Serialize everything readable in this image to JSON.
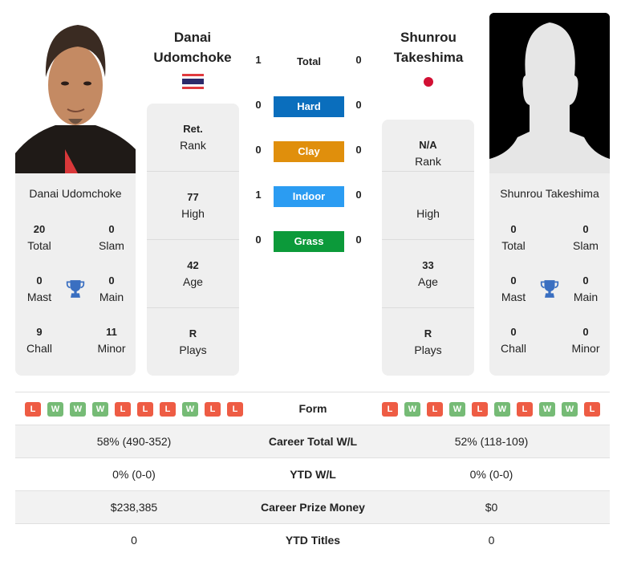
{
  "players": [
    {
      "name": "Danai Udomchoke",
      "title_line1": "Danai",
      "title_line2": "Udomchoke",
      "flag": "thailand-flag",
      "photo": "player-photo",
      "titles": {
        "total": {
          "value": "20",
          "label": "Total"
        },
        "slam": {
          "value": "0",
          "label": "Slam"
        },
        "mast": {
          "value": "0",
          "label": "Mast"
        },
        "main": {
          "value": "0",
          "label": "Main"
        },
        "chall": {
          "value": "9",
          "label": "Chall"
        },
        "minor": {
          "value": "11",
          "label": "Minor"
        }
      },
      "info": [
        {
          "value": "Ret.",
          "label": "Rank"
        },
        {
          "value": "77",
          "label": "High"
        },
        {
          "value": "42",
          "label": "Age"
        },
        {
          "value": "R",
          "label": "Plays"
        }
      ],
      "form": [
        "L",
        "W",
        "W",
        "W",
        "L",
        "L",
        "L",
        "W",
        "L",
        "L"
      ],
      "career_wl": "58% (490-352)",
      "ytd_wl": "0% (0-0)",
      "prize_money": "$238,385",
      "ytd_titles": "0"
    },
    {
      "name": "Shunrou Takeshima",
      "title_line1": "Shunrou",
      "title_line2": "Takeshima",
      "flag": "japan-flag",
      "photo": "silhouette-placeholder",
      "titles": {
        "total": {
          "value": "0",
          "label": "Total"
        },
        "slam": {
          "value": "0",
          "label": "Slam"
        },
        "mast": {
          "value": "0",
          "label": "Mast"
        },
        "main": {
          "value": "0",
          "label": "Main"
        },
        "chall": {
          "value": "0",
          "label": "Chall"
        },
        "minor": {
          "value": "0",
          "label": "Minor"
        }
      },
      "info": [
        {
          "value": "N/A",
          "label": "Rank"
        },
        {
          "value": "",
          "label": "High"
        },
        {
          "value": "33",
          "label": "Age"
        },
        {
          "value": "R",
          "label": "Plays"
        }
      ],
      "form": [
        "L",
        "W",
        "L",
        "W",
        "L",
        "W",
        "L",
        "W",
        "W",
        "L"
      ],
      "career_wl": "52% (118-109)",
      "ytd_wl": "0% (0-0)",
      "prize_money": "$0",
      "ytd_titles": "0"
    }
  ],
  "h2h": {
    "total": {
      "label": "Total",
      "left": "1",
      "right": "0"
    },
    "surfaces": [
      {
        "label": "Hard",
        "left": "0",
        "right": "0",
        "color": "#0a6ebd"
      },
      {
        "label": "Clay",
        "left": "0",
        "right": "0",
        "color": "#e08f0c"
      },
      {
        "label": "Indoor",
        "left": "1",
        "right": "0",
        "color": "#2b9cf2"
      },
      {
        "label": "Grass",
        "left": "0",
        "right": "0",
        "color": "#0c9a3a"
      }
    ]
  },
  "table": {
    "form_label": "Form",
    "career_wl_label": "Career Total W/L",
    "ytd_wl_label": "YTD W/L",
    "prize_label": "Career Prize Money",
    "ytd_titles_label": "YTD Titles"
  },
  "colors": {
    "loss": "#ee5c44",
    "win": "#76bb76",
    "trophy": "#3a6fc1"
  }
}
